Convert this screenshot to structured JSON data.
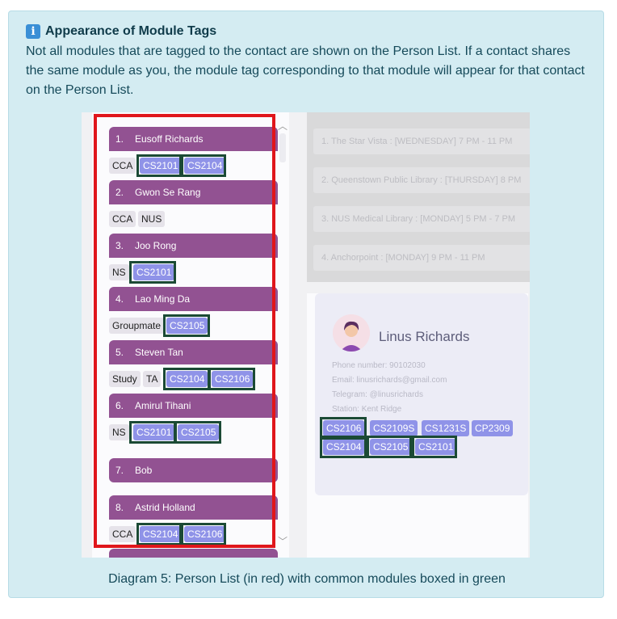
{
  "callout": {
    "icon": "information-icon",
    "title": "Appearance of Module Tags",
    "body": "Not all modules that are tagged to the contact are shown on the Person List. If a contact shares the same module as you, the module tag corresponding to that module will appear for that contact on the Person List."
  },
  "persons": [
    {
      "index": "1.",
      "name": "Eusoff Richards",
      "tags": [
        "CCA",
        "CS2101",
        "CS2104"
      ]
    },
    {
      "index": "2.",
      "name": "Gwon Se Rang",
      "tags": [
        "CCA",
        "NUS"
      ]
    },
    {
      "index": "3.",
      "name": "Joo Rong",
      "tags": [
        "NS",
        "CS2101"
      ]
    },
    {
      "index": "4.",
      "name": "Lao Ming Da",
      "tags": [
        "Groupmate",
        "CS2105"
      ]
    },
    {
      "index": "5.",
      "name": "Steven Tan",
      "tags": [
        "Study",
        "TA",
        "CS2104",
        "CS2106"
      ]
    },
    {
      "index": "6.",
      "name": "Amirul Tihani",
      "tags": [
        "NS",
        "CS2101",
        "CS2105"
      ]
    },
    {
      "index": "7.",
      "name": "Bob",
      "tags": []
    },
    {
      "index": "8.",
      "name": "Astrid Holland",
      "tags": [
        "CCA",
        "CS2104",
        "CS2106"
      ]
    }
  ],
  "schedule": [
    "1.    The Star Vista : [WEDNESDAY] 7 PM - 11 PM",
    "2.    Queenstown Public Library : [THURSDAY] 8 PM",
    "3.    NUS Medical Library : [MONDAY] 5 PM - 7 PM",
    "4.    Anchorpoint : [MONDAY] 9 PM - 11 PM"
  ],
  "contact": {
    "name": "Linus Richards",
    "phone": "Phone number: 90102030",
    "email": "Email: linusrichards@gmail.com",
    "telegram": "Telegram: @linusrichards",
    "station": "Station: Kent Ridge",
    "modules": [
      "CS2106",
      "CS2109S",
      "CS1231S",
      "CP2309",
      "CS2104",
      "CS2105",
      "CS2101"
    ]
  },
  "caption": "Diagram 5: Person List (in red) with common modules boxed in green",
  "colors": {
    "callout_bg": "#d4ecf2",
    "person_bar": "#925292",
    "module_tag": "#8f93e8",
    "red_outline": "#e0161b",
    "green_outline": "#1b4a35"
  }
}
